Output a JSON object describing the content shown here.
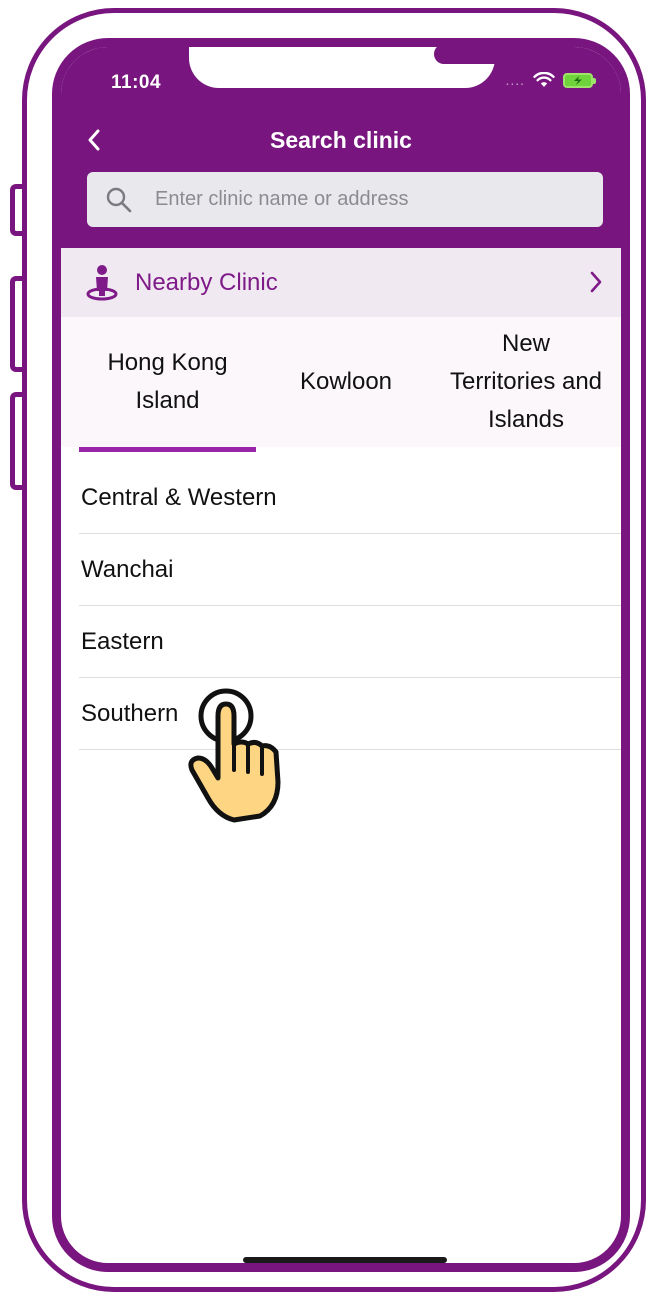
{
  "status_bar": {
    "time": "11:04",
    "signal": "....",
    "wifi_icon": "wifi-icon",
    "battery_icon": "battery-charging-icon"
  },
  "header": {
    "title": "Search clinic",
    "back_icon": "chevron-left-icon"
  },
  "search": {
    "placeholder": "Enter clinic name or address",
    "value": ""
  },
  "nearby": {
    "label": "Nearby Clinic",
    "icon": "person-location-icon"
  },
  "tabs": [
    {
      "label": "Hong Kong Island",
      "line1": "Hong Kong",
      "line2": "Island",
      "selected": true
    },
    {
      "label": "Kowloon",
      "selected": false
    },
    {
      "label": "New Territories and Islands",
      "line1": "New",
      "line2": "Territories and",
      "line3": "Islands",
      "selected": false
    }
  ],
  "districts": [
    "Central & Western",
    "Wanchai",
    "Eastern",
    "Southern"
  ],
  "colors": {
    "primary": "#78157e",
    "accent": "#9b25a8",
    "nearby_bg": "#f1e9f1",
    "hand_fill": "#fdd583"
  }
}
